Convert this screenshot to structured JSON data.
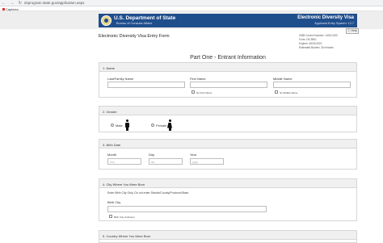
{
  "browser": {
    "url": "dvprogram.state.gov/application.aspx",
    "bookmark": "Capterra"
  },
  "header": {
    "dept": "U.S. Department of State",
    "bureau": "Bureau of Consular Affairs",
    "title": "Electronic Diversity Visa",
    "system": "Applicant Entry System: 12.7"
  },
  "help_label": "Help",
  "form_title": "Electronic Diversity Visa Entry Form",
  "meta": {
    "omb": "OMB Control Number: 1405-0153",
    "form": "Form: DS-5501",
    "expires": "Expires: 08/31/2022",
    "burden": "Estimated Burden: 30 minutes"
  },
  "part_title": "Part One - Entrant Information",
  "sections": {
    "name": {
      "heading": "1. Name",
      "last_label": "Last/Family Name",
      "first_label": "First Name",
      "middle_label": "Middle Name",
      "no_first": "No First Name",
      "no_middle": "No Middle Name"
    },
    "gender": {
      "heading": "2. Gender",
      "male": "Male",
      "female": "Female"
    },
    "birth_date": {
      "heading": "3. Birth Date",
      "month_label": "Month",
      "day_label": "Day",
      "year_label": "Year",
      "month_ph": "mm",
      "day_ph": "dd",
      "year_ph": "yyyy"
    },
    "birth_city": {
      "heading": "4. City Where You Were Born",
      "instruction": "Enter Birth City Only. Do not enter District/County/Province/State.",
      "city_label": "Birth City",
      "unknown": "Birth City Unknown"
    },
    "birth_country": {
      "heading": "5. Country Where You Were Born"
    }
  }
}
